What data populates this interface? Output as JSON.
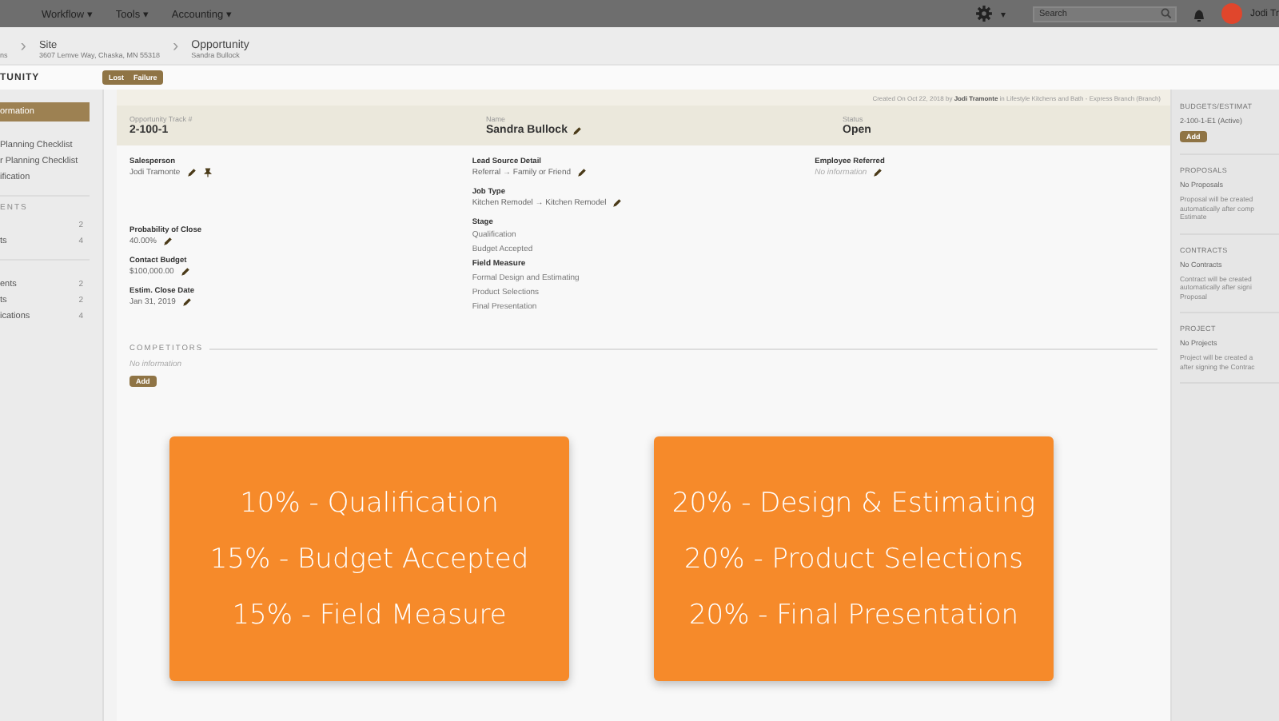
{
  "top_nav": {
    "menus": [
      {
        "label": "Workflow",
        "caret": "▾"
      },
      {
        "label": "Tools",
        "caret": "▾"
      },
      {
        "label": "Accounting",
        "caret": "▾"
      }
    ],
    "settings_caret": "▾",
    "search": {
      "placeholder": "Search"
    },
    "user": "Jodi Tr"
  },
  "breadcrumb": [
    {
      "detail": "ns"
    },
    {
      "separator": "›",
      "title": "Site",
      "detail": "3607 Lemve Way, Chaska, MN 55318"
    },
    {
      "separator": "›",
      "title": "Opportunity",
      "detail": "Sandra Bullock"
    }
  ],
  "page_title": "TUNITY",
  "header_buttons": [
    "Lost",
    "Failure"
  ],
  "sidebar": {
    "items": [
      {
        "label": "ormation",
        "selected": true
      },
      {
        "label": "Planning Checklist",
        "selected": false
      },
      {
        "label": "r Planning Checklist",
        "selected": false
      },
      {
        "label": "ification",
        "selected": false
      }
    ],
    "sections": [
      {
        "heading": "ENTS",
        "items": [
          {
            "count": "2"
          },
          {
            "label": "ts",
            "count": "4"
          }
        ]
      },
      {
        "items": [
          {
            "label": "ents",
            "count": "2"
          },
          {
            "label": "ts",
            "count": "2"
          },
          {
            "label": "ications",
            "count": "4"
          }
        ]
      }
    ]
  },
  "created_note": "Created On Oct 22, 2018 by **Jodi Tramonte** in Lifestyle Kitchens and Bath - Express Branch (Branch)",
  "summary": [
    {
      "label": "Opportunity Track #",
      "value": "2-100-1"
    },
    {
      "label": "Name",
      "value": "Sandra Bullock",
      "icons": [
        {
          "kind": "pencil"
        }
      ]
    },
    {
      "label": "Status",
      "value": "Open"
    }
  ],
  "columns": [
    [
      {
        "label": "Salesperson",
        "value": "Jodi Tramonte",
        "empty": false,
        "icons": [
          {
            "kind": "pencil"
          },
          {
            "kind": "pin"
          }
        ]
      },
      {
        "label": "Probability of Close",
        "value": "40.00%",
        "empty": false,
        "icons": [
          {
            "kind": "pencil"
          }
        ]
      },
      {
        "label": "Contact Budget",
        "value": "$100,000.00",
        "empty": false,
        "icons": [
          {
            "kind": "pencil"
          }
        ]
      },
      {
        "label": "Estim. Close Date",
        "value": "Jan 31, 2019",
        "empty": false,
        "icons": [
          {
            "kind": "pencil"
          }
        ]
      }
    ],
    [
      {
        "label": "Lead Source Detail",
        "value": "Referral → Family or Friend",
        "empty": false,
        "icons": [
          {
            "kind": "pencil"
          }
        ]
      },
      {
        "label": "Job Type",
        "value": "Kitchen Remodel → Kitchen Remodel",
        "empty": false,
        "icons": [
          {
            "kind": "pencil"
          }
        ]
      }
    ],
    [
      {
        "label": "Employee Referred",
        "value": "No information",
        "empty": true,
        "icons": [
          {
            "kind": "pencil"
          }
        ]
      }
    ]
  ],
  "stage": {
    "label": "Stage",
    "items": [
      {
        "name": "Qualification",
        "current": false
      },
      {
        "name": "Budget Accepted",
        "current": false
      },
      {
        "name": "Field Measure",
        "current": true
      },
      {
        "name": "Formal Design and Estimating",
        "current": false
      },
      {
        "name": "Product Selections",
        "current": false
      },
      {
        "name": "Final Presentation",
        "current": false
      }
    ]
  },
  "competitors": {
    "heading": "COMPETITORS",
    "empty_text": "No information",
    "button": "Add"
  },
  "right_panel": [
    {
      "heading": "BUDGETS/ESTIMAT",
      "lines": [
        "2-100-1-E1 (Active)"
      ],
      "button": "Add"
    },
    {
      "heading": "PROPOSALS",
      "lines": [
        "No Proposals"
      ],
      "note": [
        "Proposal will be created",
        "automatically after comp",
        "Estimate"
      ]
    },
    {
      "heading": "CONTRACTS",
      "lines": [
        "No Contracts"
      ],
      "note": [
        "Contract will be created",
        "automatically after signi",
        "Proposal"
      ]
    },
    {
      "heading": "PROJECT",
      "lines": [
        "No Projects"
      ],
      "note": [
        "Project will be created a",
        "after signing the Contrac"
      ]
    }
  ],
  "overlay_cards": [
    [
      "10% - Qualification",
      "15% - Budget Accepted",
      "15% - Field Measure"
    ],
    [
      "20% - Design & Estimating",
      "20% - Product Selections",
      "20% - Final Presentation"
    ]
  ]
}
